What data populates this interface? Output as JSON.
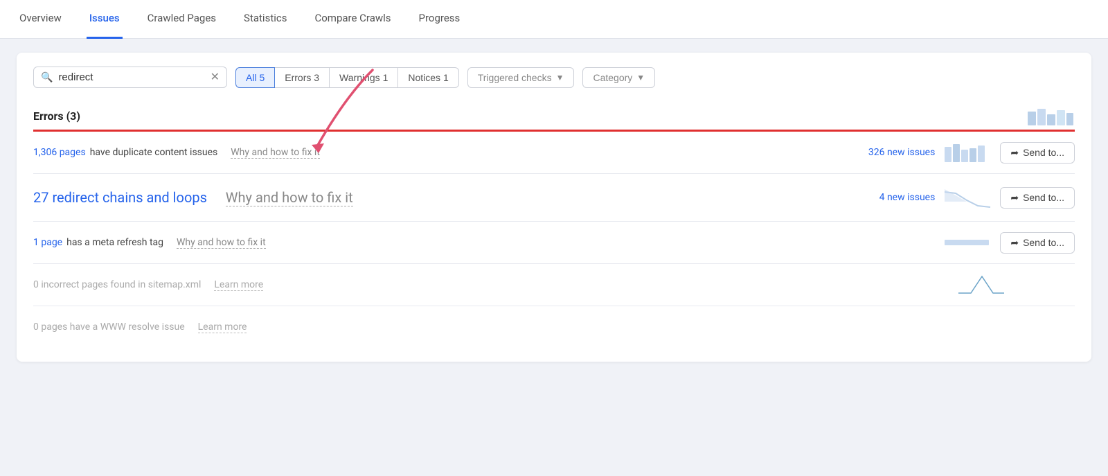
{
  "nav": {
    "items": [
      {
        "label": "Overview",
        "active": false
      },
      {
        "label": "Issues",
        "active": true
      },
      {
        "label": "Crawled Pages",
        "active": false
      },
      {
        "label": "Statistics",
        "active": false
      },
      {
        "label": "Compare Crawls",
        "active": false
      },
      {
        "label": "Progress",
        "active": false
      }
    ]
  },
  "filter": {
    "search_value": "redirect",
    "tabs": [
      {
        "label": "All",
        "count": "5",
        "active": true
      },
      {
        "label": "Errors",
        "count": "3",
        "active": false
      },
      {
        "label": "Warnings",
        "count": "1",
        "active": false
      },
      {
        "label": "Notices",
        "count": "1",
        "active": false
      }
    ],
    "triggered_checks_label": "Triggered checks",
    "category_label": "Category"
  },
  "errors_section": {
    "title": "Errors",
    "count": "(3)"
  },
  "issues": [
    {
      "id": "duplicate-content",
      "link_text": "1,306 pages",
      "text_before": "",
      "text_after": "have duplicate content issues",
      "why_fix": "Why and how to fix it",
      "new_issues": "326 new issues",
      "has_send": true,
      "send_label": "Send to...",
      "large": false,
      "muted": false,
      "spark_type": "bar"
    },
    {
      "id": "redirect-chains",
      "link_text": "27 redirect chains and loops",
      "text_before": "",
      "text_after": "",
      "why_fix": "Why and how to fix it",
      "new_issues": "4 new issues",
      "has_send": true,
      "send_label": "Send to...",
      "large": true,
      "muted": false,
      "spark_type": "slope"
    },
    {
      "id": "meta-refresh",
      "link_text": "1 page",
      "text_before": "",
      "text_after": "has a meta refresh tag",
      "why_fix": "Why and how to fix it",
      "new_issues": "",
      "has_send": true,
      "send_label": "Send to...",
      "large": false,
      "muted": false,
      "spark_type": "flat"
    },
    {
      "id": "sitemap-incorrect",
      "link_text": "0 incorrect pages found in sitemap.xml",
      "text_before": "",
      "text_after": "",
      "learn_more": "Learn more",
      "new_issues": "",
      "has_send": false,
      "large": false,
      "muted": true,
      "spark_type": "spike"
    },
    {
      "id": "www-resolve",
      "link_text": "0 pages have a WWW resolve issue",
      "text_before": "",
      "text_after": "",
      "learn_more": "Learn more",
      "new_issues": "",
      "has_send": false,
      "large": false,
      "muted": true,
      "spark_type": "none"
    }
  ]
}
